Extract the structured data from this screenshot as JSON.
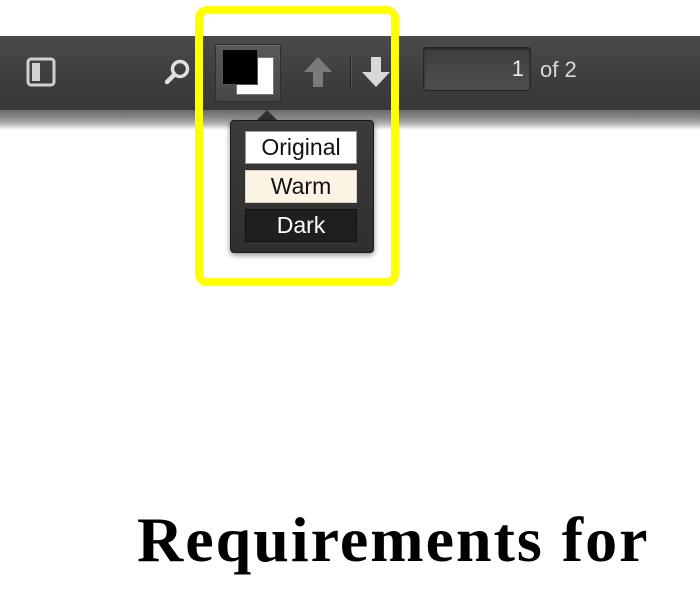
{
  "toolbar": {
    "sidebar_toggle_icon": "sidebar-toggle-icon",
    "find_icon": "search-icon",
    "theme_icon": "theme-swatch-icon",
    "prev_icon": "arrow-up-icon",
    "next_icon": "arrow-down-icon",
    "page_number": "1",
    "page_count": "of 2"
  },
  "theme_menu": {
    "options": [
      {
        "label": "Original",
        "background": "#ffffff"
      },
      {
        "label": "Warm",
        "background": "#fbf3e4"
      },
      {
        "label": "Dark",
        "background": "#1f1f1f"
      }
    ]
  },
  "annotation": {
    "highlight_color": "#ffff00"
  },
  "document": {
    "heading": "Requirements for"
  }
}
